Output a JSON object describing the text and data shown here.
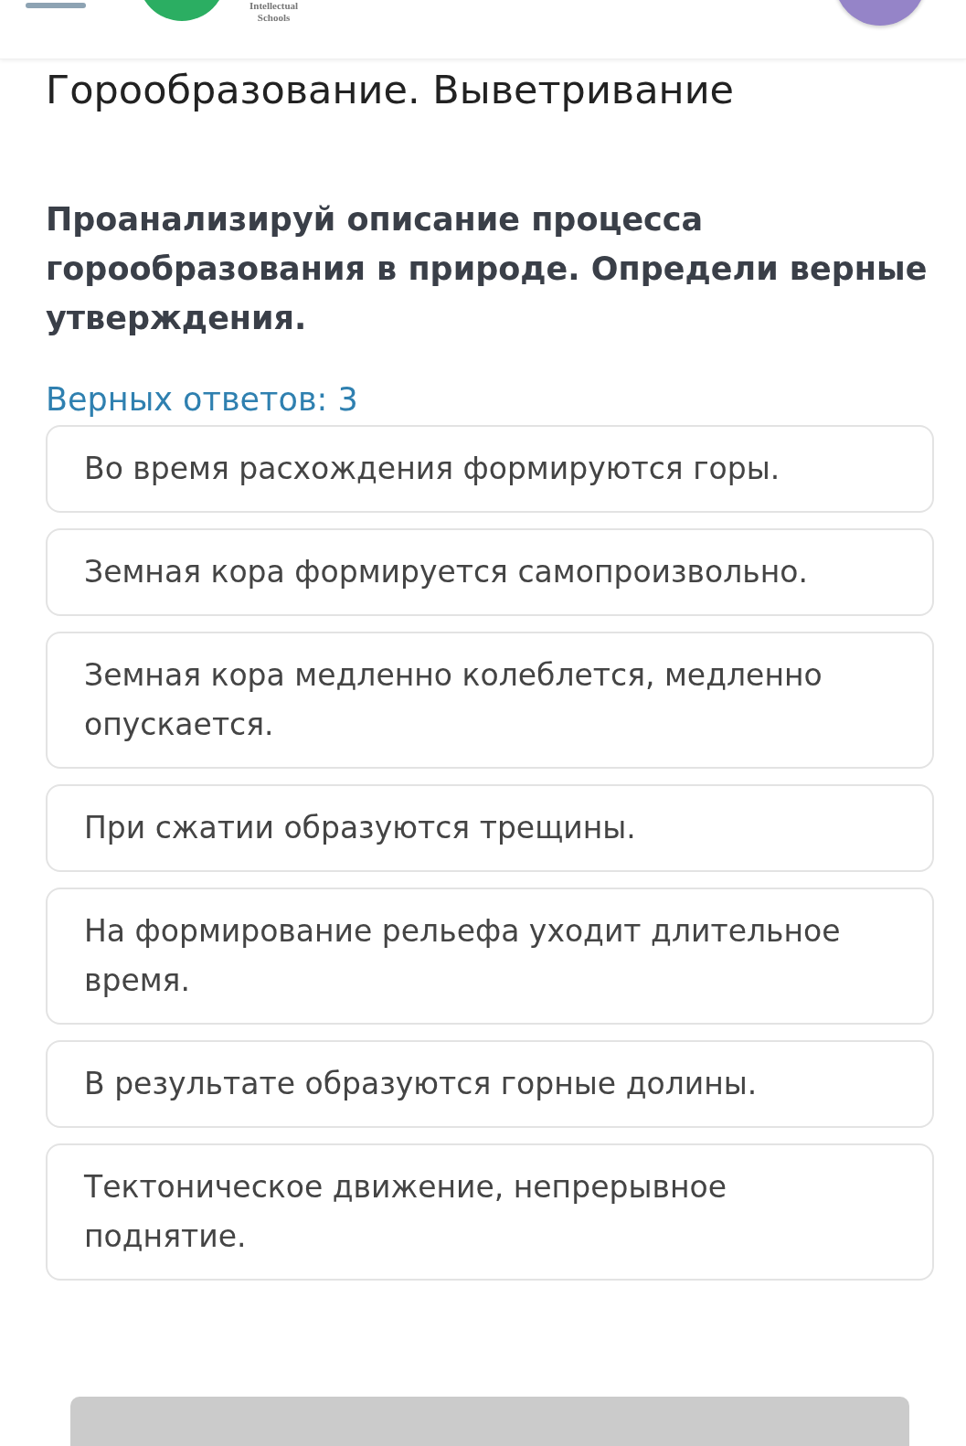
{
  "header": {
    "logo_text": [
      "Intellectual",
      "Schools"
    ]
  },
  "title": "Горообразование. Выветривание",
  "question": "Проанализируй описание процесса горообразования в природе. Определи верные утверждения.",
  "answer_count": "Верных ответов: 3",
  "options": [
    {
      "text": "Во время расхождения формируются горы.",
      "selected": false
    },
    {
      "text": "Земная кора формируется самопроизвольно.",
      "selected": false
    },
    {
      "text": "Земная кора медленно колеблется, медленно опускается.",
      "selected": false
    },
    {
      "text": "При сжатии образуются трещины.",
      "selected": false
    },
    {
      "text": "На формирование рельефа уходит длительное время.",
      "selected": false
    },
    {
      "text": "В результате образуются горные долины.",
      "selected": false
    },
    {
      "text": "Тектоническое движение, непрерывное поднятие.",
      "selected": false
    }
  ],
  "submit": {
    "disabled": true
  }
}
